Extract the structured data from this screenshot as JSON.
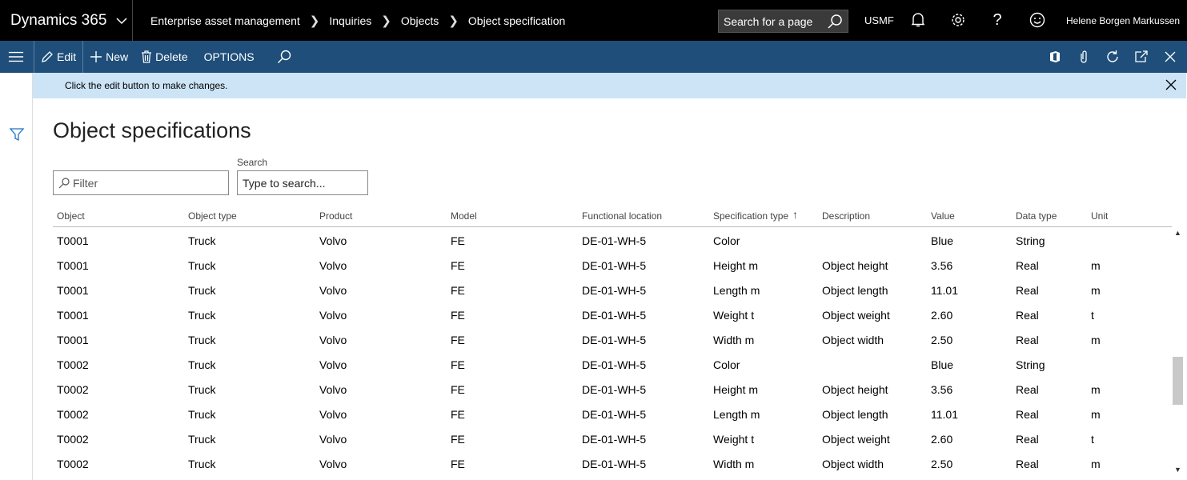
{
  "app": {
    "name": "Dynamics 365"
  },
  "breadcrumb": [
    "Enterprise asset management",
    "Inquiries",
    "Objects",
    "Object specification"
  ],
  "topbar": {
    "search_placeholder": "Search for a page",
    "company": "USMF",
    "user": "Helene Borgen Markussen"
  },
  "actionbar": {
    "edit": "Edit",
    "new": "New",
    "delete": "Delete",
    "options": "OPTIONS"
  },
  "info": {
    "message": "Click the edit button to make changes."
  },
  "page": {
    "title": "Object specifications",
    "filter_placeholder": "Filter",
    "search_label": "Search",
    "search_value": "Type to search..."
  },
  "grid": {
    "columns": [
      "Object",
      "Object type",
      "Product",
      "Model",
      "Functional location",
      "Specification type",
      "Description",
      "Value",
      "Data type",
      "Unit"
    ],
    "sort_indicator": "↑",
    "rows": [
      [
        "T0001",
        "Truck",
        "Volvo",
        "FE",
        "DE-01-WH-5",
        "Color",
        "",
        "Blue",
        "String",
        ""
      ],
      [
        "T0001",
        "Truck",
        "Volvo",
        "FE",
        "DE-01-WH-5",
        "Height m",
        "Object height",
        "3.56",
        "Real",
        "m"
      ],
      [
        "T0001",
        "Truck",
        "Volvo",
        "FE",
        "DE-01-WH-5",
        "Length m",
        "Object length",
        "11.01",
        "Real",
        "m"
      ],
      [
        "T0001",
        "Truck",
        "Volvo",
        "FE",
        "DE-01-WH-5",
        "Weight t",
        "Object weight",
        "2.60",
        "Real",
        "t"
      ],
      [
        "T0001",
        "Truck",
        "Volvo",
        "FE",
        "DE-01-WH-5",
        "Width m",
        "Object width",
        "2.50",
        "Real",
        "m"
      ],
      [
        "T0002",
        "Truck",
        "Volvo",
        "FE",
        "DE-01-WH-5",
        "Color",
        "",
        "Blue",
        "String",
        ""
      ],
      [
        "T0002",
        "Truck",
        "Volvo",
        "FE",
        "DE-01-WH-5",
        "Height m",
        "Object height",
        "3.56",
        "Real",
        "m"
      ],
      [
        "T0002",
        "Truck",
        "Volvo",
        "FE",
        "DE-01-WH-5",
        "Length m",
        "Object length",
        "11.01",
        "Real",
        "m"
      ],
      [
        "T0002",
        "Truck",
        "Volvo",
        "FE",
        "DE-01-WH-5",
        "Weight t",
        "Object weight",
        "2.60",
        "Real",
        "t"
      ],
      [
        "T0002",
        "Truck",
        "Volvo",
        "FE",
        "DE-01-WH-5",
        "Width m",
        "Object width",
        "2.50",
        "Real",
        "m"
      ]
    ]
  }
}
